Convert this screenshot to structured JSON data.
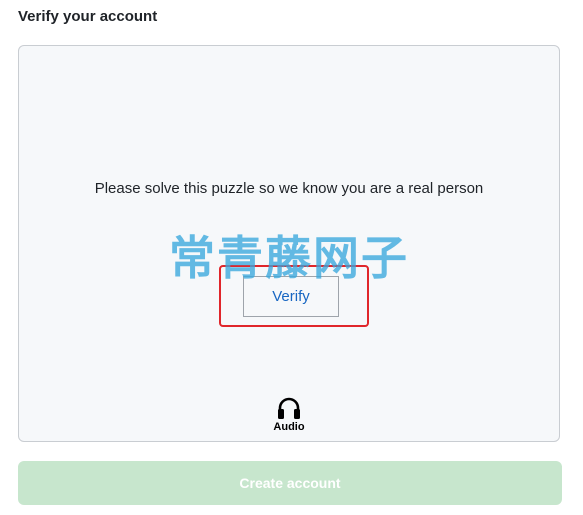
{
  "page": {
    "title": "Verify your account"
  },
  "puzzle": {
    "prompt": "Please solve this puzzle so we know you are a real person",
    "verify_label": "Verify",
    "audio_label": "Audio",
    "highlight_color": "#e0262b",
    "verify_text_color": "#1766c2"
  },
  "watermark": {
    "text": "常青藤网子",
    "color": "#39a8dd"
  },
  "footer": {
    "create_account_label": "Create account",
    "create_account_color": "#c7e6cd",
    "create_account_state": "disabled"
  },
  "icons": {
    "audio": "headphones-icon"
  }
}
